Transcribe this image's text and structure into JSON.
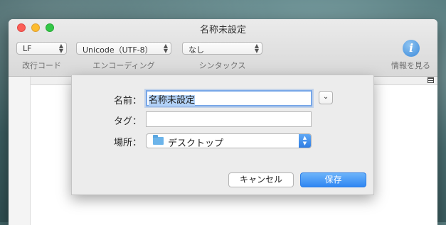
{
  "window": {
    "title": "名称未設定"
  },
  "toolbar": {
    "line_ending": {
      "value": "LF",
      "label": "改行コード"
    },
    "encoding": {
      "value": "Unicode（UTF-8）",
      "label": "エンコーディング"
    },
    "syntax": {
      "value": "なし",
      "label": "シンタックス"
    },
    "info": {
      "icon": "i",
      "label": "情報を見る"
    }
  },
  "save_sheet": {
    "name_label": "名前：",
    "name_value": "名称未設定",
    "tags_label": "タグ：",
    "tags_value": "",
    "location_label": "場所：",
    "location_value": "デスクトップ",
    "disclosure_icon": "⌄",
    "cancel_label": "キャンセル",
    "save_label": "保存"
  },
  "colors": {
    "accent": "#2f86f2",
    "selection": "#b3d2f7",
    "close": "#fc5f57",
    "minimize": "#fdbc2e",
    "zoom": "#33c748"
  }
}
